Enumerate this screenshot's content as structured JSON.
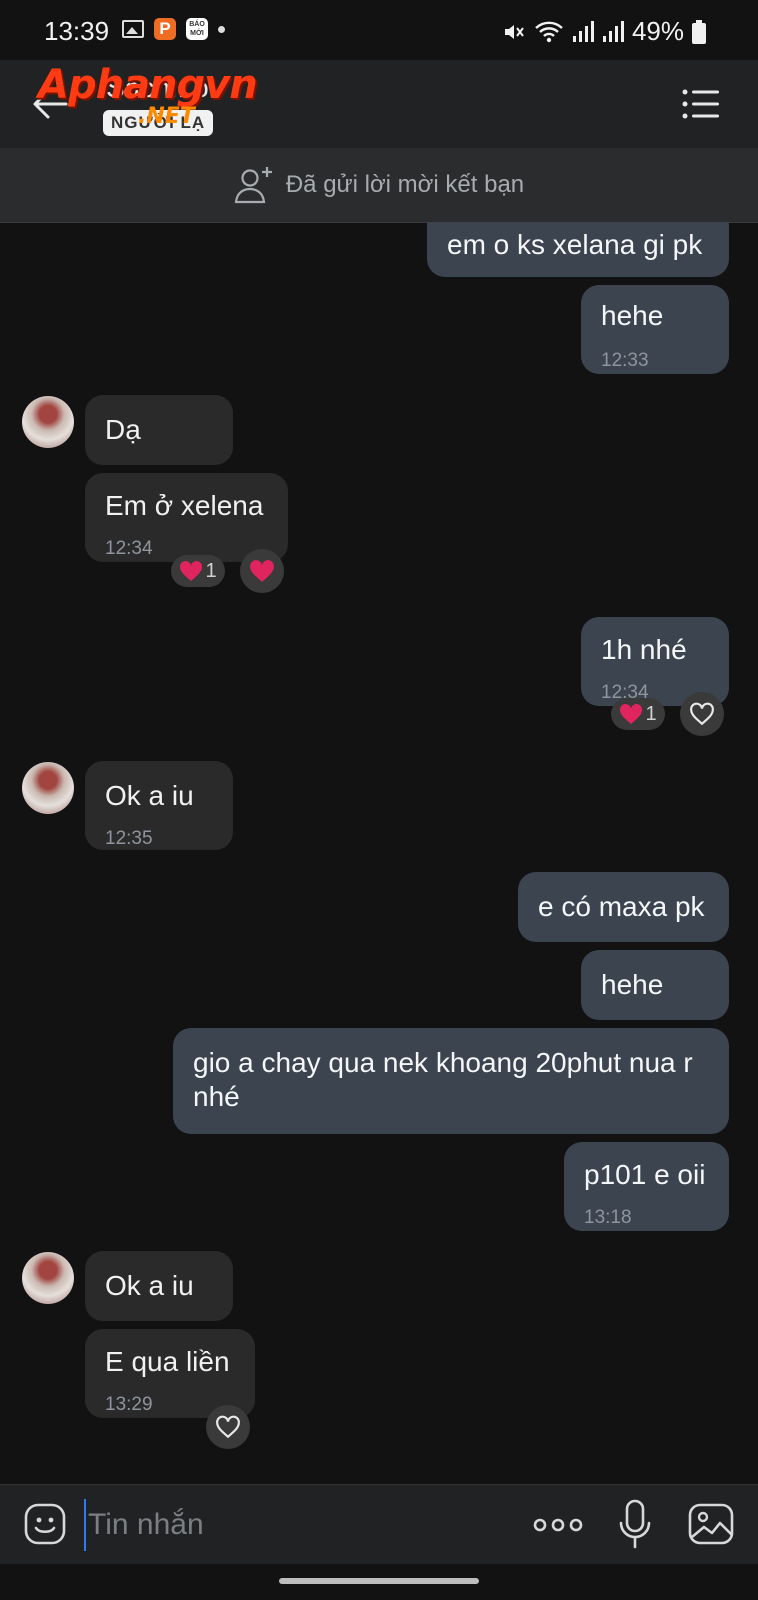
{
  "status_bar": {
    "time": "13:39",
    "app_icon_label": "BÁO MỚI",
    "battery": "49%"
  },
  "header": {
    "contact_name": "Sach...o",
    "contact_badge": "NGƯỜI LẠ",
    "watermark_main": "Aphangvn",
    "watermark_sub": ".NET"
  },
  "friend_banner": {
    "text": "Đã gửi lời mời kết bạn"
  },
  "messages": [
    {
      "dir": "out",
      "text": "em o ks xelana gi pk"
    },
    {
      "dir": "out",
      "text": "hehe",
      "time": "12:33"
    },
    {
      "dir": "in",
      "text": "Dạ"
    },
    {
      "dir": "in",
      "text": "Em ở xelena",
      "time": "12:34",
      "reaction_count": "1"
    },
    {
      "dir": "out",
      "text": "1h nhé",
      "time": "12:34",
      "reaction_count": "1"
    },
    {
      "dir": "in",
      "text": "Ok a iu",
      "time": "12:35"
    },
    {
      "dir": "out",
      "text": "e có maxa pk"
    },
    {
      "dir": "out",
      "text": "hehe"
    },
    {
      "dir": "out",
      "text": "gio a chay qua nek khoang 20phut nua r nhé"
    },
    {
      "dir": "out",
      "text": "p101 e oii",
      "time": "13:18"
    },
    {
      "dir": "in",
      "text": "Ok a iu"
    },
    {
      "dir": "in",
      "text": "E qua liền",
      "time": "13:29"
    }
  ],
  "input_bar": {
    "placeholder": "Tin nhắn"
  },
  "icons": {
    "heart_color": "#e0245e",
    "accent": "#2f7bf5"
  }
}
